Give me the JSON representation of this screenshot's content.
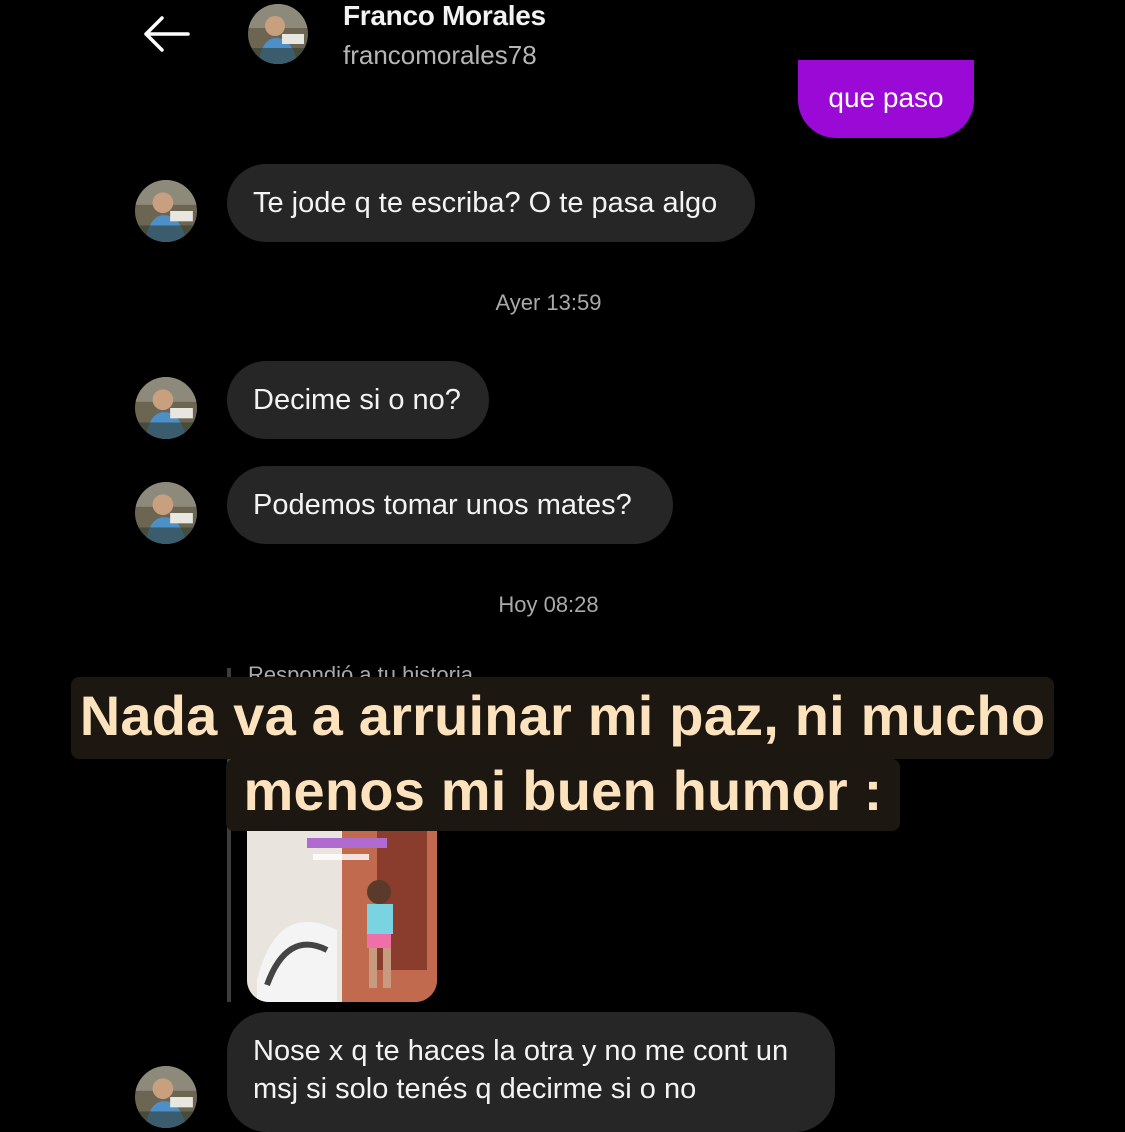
{
  "header": {
    "back_icon": "arrow-left-icon",
    "name": "Franco Morales",
    "username": "francomorales78"
  },
  "outgoing": [
    {
      "text": "que paso"
    }
  ],
  "messages": [
    {
      "text": "Te jode q te escriba? O te pasa algo"
    },
    {
      "text": "Decime si o no?"
    },
    {
      "text": "Podemos tomar unos mates?"
    },
    {
      "text": "Nose x q te haces la otra y no me cont un msj si solo tenés q decirme si o no"
    }
  ],
  "timestamps": [
    "Ayer 13:59",
    "Hoy 08:28"
  ],
  "story_reply": {
    "label": "Respondió a tu historia"
  },
  "caption": {
    "line1": "Nada va a arruinar mi paz, ni mucho",
    "line2": "menos mi buen humor :"
  },
  "colors": {
    "background": "#000000",
    "incoming_bubble": "#262626",
    "outgoing_bubble": "#9a09d6",
    "caption_text": "#fde2be",
    "caption_bg": "#1c1710"
  }
}
